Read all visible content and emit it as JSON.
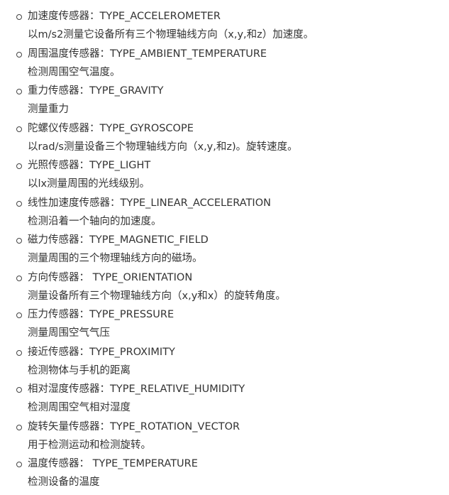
{
  "sensors": [
    {
      "title": "加速度传感器：TYPE_ACCELEROMETER",
      "desc": "以m/s2测量它设备所有三个物理轴线方向（x,y,和z）加速度。"
    },
    {
      "title": "周围温度传感器：TYPE_AMBIENT_TEMPERATURE",
      "desc": "检测周围空气温度。"
    },
    {
      "title": "重力传感器：TYPE_GRAVITY",
      "desc": "测量重力"
    },
    {
      "title": "陀螺仪传感器：TYPE_GYROSCOPE",
      "desc": "以rad/s测量设备三个物理轴线方向（x,y,和z)。旋转速度。"
    },
    {
      "title": "光照传感器：TYPE_LIGHT",
      "desc": "以lx测量周围的光线级别。"
    },
    {
      "title": "线性加速度传感器：TYPE_LINEAR_ACCELERATION",
      "desc": "检测沿着一个轴向的加速度。"
    },
    {
      "title": "磁力传感器：TYPE_MAGNETIC_FIELD",
      "desc": "测量周围的三个物理轴线方向的磁场。"
    },
    {
      "title": "方向传感器： TYPE_ORIENTATION",
      "desc": "测量设备所有三个物理轴线方向（x,y和x）的旋转角度。"
    },
    {
      "title": "压力传感器：TYPE_PRESSURE",
      "desc": "测量周围空气气压"
    },
    {
      "title": "接近传感器：TYPE_PROXIMITY",
      "desc": "检测物体与手机的距离"
    },
    {
      "title": "相对湿度传感器：TYPE_RELATIVE_HUMIDITY",
      "desc": "检测周围空气相对湿度"
    },
    {
      "title": "旋转矢量传感器：TYPE_ROTATION_VECTOR",
      "desc": "用于检测运动和检测旋转。"
    },
    {
      "title": "温度传感器： TYPE_TEMPERATURE",
      "desc": "检测设备的温度"
    }
  ]
}
